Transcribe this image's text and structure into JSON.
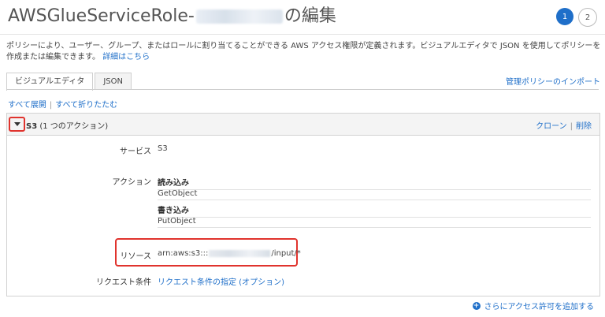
{
  "header": {
    "title_prefix": "AWSGlueServiceRole-",
    "title_suffix": "の編集",
    "steps": [
      "1",
      "2"
    ]
  },
  "description": {
    "text": "ポリシーにより、ユーザー、グループ、またはロールに割り当てることができる AWS アクセス権限が定義されます。ビジュアルエディタで JSON を使用してポリシーを作成または編集できます。",
    "link": "詳細はこちら"
  },
  "tabs": [
    "ビジュアルエディタ",
    "JSON"
  ],
  "import_link": "管理ポリシーのインポート",
  "expand": {
    "expand_all": "すべて展開",
    "collapse_all": "すべて折りたたむ"
  },
  "statement": {
    "service_name": "S3",
    "subtitle": "(1 つのアクション)",
    "clone": "クローン",
    "delete": "削除",
    "service_label": "サービス",
    "service_value": "S3",
    "actions_label": "アクション",
    "read_header": "読み込み",
    "read_action": "GetObject",
    "write_header": "書き込み",
    "write_action": "PutObject",
    "resource_label": "リソース",
    "resource_prefix": "arn:aws:s3:::",
    "resource_suffix": "/input/*",
    "condition_label": "リクエスト条件",
    "condition_link": "リクエスト条件の指定 (オプション)"
  },
  "add_permissions": "さらにアクセス許可を追加する",
  "colors": {
    "accent": "#1f6fc9",
    "highlight": "#e0332d"
  }
}
